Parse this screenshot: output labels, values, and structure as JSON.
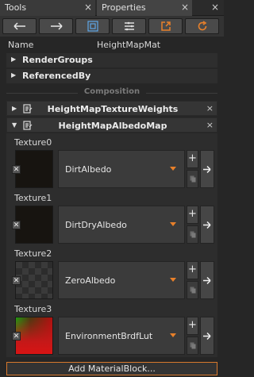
{
  "tabs": [
    {
      "label": "Tools"
    },
    {
      "label": "Properties"
    }
  ],
  "toolbar": {
    "buttons": [
      {
        "icon": "arrow-left-icon"
      },
      {
        "icon": "arrow-right-icon"
      },
      {
        "icon": "select-frame-icon"
      },
      {
        "icon": "filter-list-icon"
      },
      {
        "icon": "open-external-icon"
      },
      {
        "icon": "refresh-icon"
      }
    ],
    "accent_color": "#e8802a"
  },
  "name_field": {
    "label": "Name",
    "value": "HeightMapMat"
  },
  "groups": [
    {
      "label": "RenderGroups"
    },
    {
      "label": "ReferencedBy"
    }
  ],
  "section_title": "Composition",
  "components": [
    {
      "label": "HeightMapTextureWeights",
      "expanded": false
    },
    {
      "label": "HeightMapAlbedoMap",
      "expanded": true
    }
  ],
  "textures": [
    {
      "label": "Texture0",
      "value": "DirtAlbedo"
    },
    {
      "label": "Texture1",
      "value": "DirtDryAlbedo"
    },
    {
      "label": "Texture2",
      "value": "ZeroAlbedo"
    },
    {
      "label": "Texture3",
      "value": "EnvironmentBrdfLut"
    }
  ],
  "glyphs": {
    "close": "×",
    "plus": "+",
    "arrow_right": "▶",
    "arrow_down": "▼",
    "x_mark": "✕"
  },
  "add_button": "Add MaterialBlock..."
}
